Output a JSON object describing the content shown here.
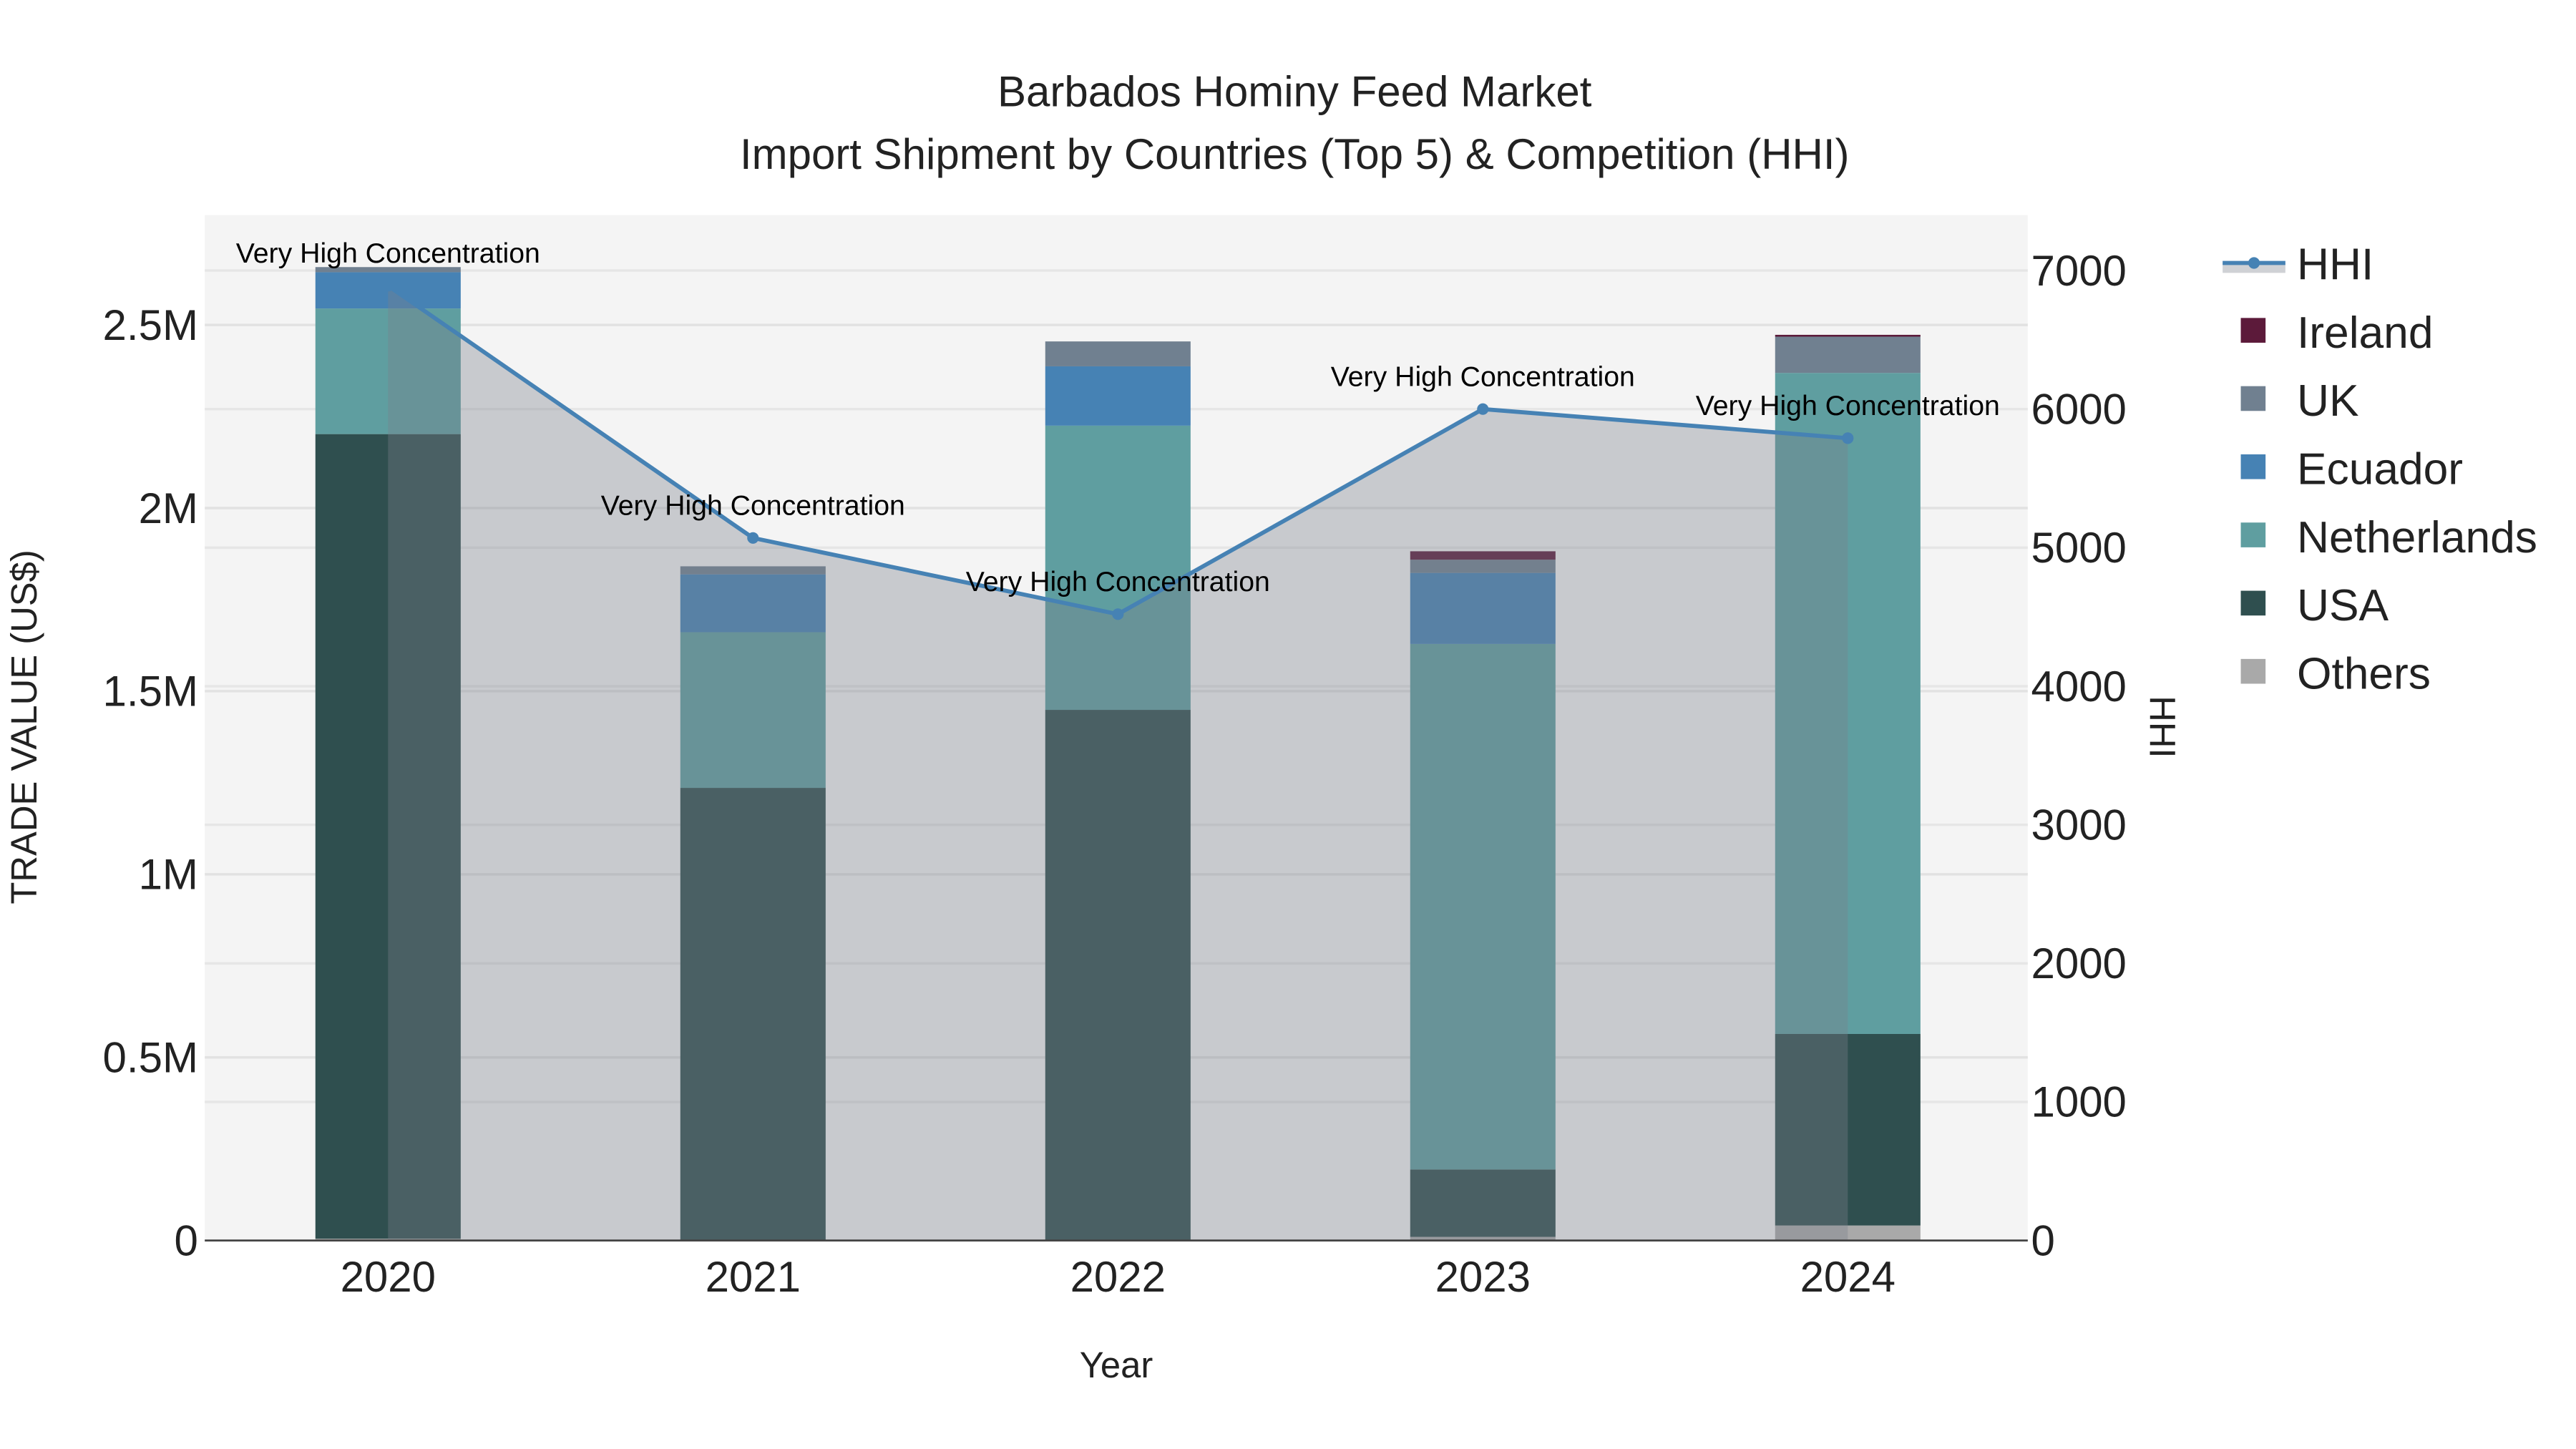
{
  "chart_data": {
    "type": "bar",
    "barmode": "stack",
    "title": "Barbados Hominy Feed Market",
    "subtitle": "Import Shipment by Countries (Top 5) & Competition (HHI)",
    "xlabel": "Year",
    "ylabel": "TRADE VALUE (US$)",
    "y2label": "HHI",
    "categories": [
      "2020",
      "2021",
      "2022",
      "2023",
      "2024"
    ],
    "ylim": [
      0,
      2800000
    ],
    "y2lim": [
      0,
      7400
    ],
    "yticks": [
      0,
      500000,
      1000000,
      1500000,
      2000000,
      2500000
    ],
    "yticklabels": [
      "0",
      "0.5M",
      "1M",
      "1.5M",
      "2M",
      "2.5M"
    ],
    "y2ticks": [
      0,
      1000,
      2000,
      3000,
      4000,
      5000,
      6000,
      7000
    ],
    "y2ticklabels": [
      "0",
      "1000",
      "2000",
      "3000",
      "4000",
      "5000",
      "6000",
      "7000"
    ],
    "series": [
      {
        "name": "Others",
        "color": "#a9a9a9",
        "values": [
          5000,
          2000,
          1000,
          10000,
          41000
        ]
      },
      {
        "name": "USA",
        "color": "#2f4f4f",
        "values": [
          2197000,
          1234000,
          1448000,
          184000,
          523000
        ]
      },
      {
        "name": "Netherlands",
        "color": "#5f9ea0",
        "values": [
          343000,
          425000,
          776000,
          1435000,
          1805000
        ]
      },
      {
        "name": "Ecuador",
        "color": "#4682b4",
        "values": [
          99000,
          158000,
          162000,
          194000,
          0
        ]
      },
      {
        "name": "UK",
        "color": "#708090",
        "values": [
          14000,
          22000,
          68000,
          36000,
          99000
        ]
      },
      {
        "name": "Ireland",
        "color": "#5c1a3a",
        "values": [
          0,
          0,
          0,
          23000,
          5000
        ]
      }
    ],
    "line": {
      "name": "HHI",
      "color": "#4682b4",
      "axis": "right",
      "values": [
        6890,
        5070,
        4520,
        6000,
        5790
      ],
      "annotations": [
        "Very High Concentration",
        "Very High Concentration",
        "Very High Concentration",
        "Very High Concentration",
        "Very High Concentration"
      ]
    },
    "legend_order": [
      "HHI",
      "Ireland",
      "UK",
      "Ecuador",
      "Netherlands",
      "USA",
      "Others"
    ],
    "legend_position": "right",
    "grid": true
  }
}
